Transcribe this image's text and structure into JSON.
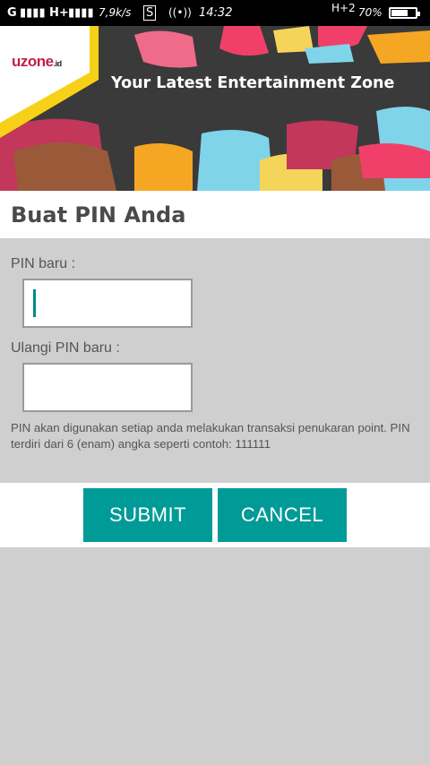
{
  "status_bar": {
    "signal1": "G",
    "signal2": "H+",
    "speed": "7,9k/s",
    "network_badge": "H+2",
    "battery": "70%",
    "time": "14:32",
    "battery_level": 0.7
  },
  "banner": {
    "logo_main": "uzone",
    "logo_suffix": ".id",
    "tagline": "Your Latest Entertainment Zone"
  },
  "page": {
    "title": "Buat PIN Anda"
  },
  "form": {
    "new_pin_label": "PIN baru :",
    "new_pin_value": "",
    "repeat_pin_label": "Ulangi PIN baru :",
    "repeat_pin_value": "",
    "hint": "PIN akan digunakan setiap anda melakukan transaksi penukaran point. PIN terdiri dari 6 (enam) angka seperti contoh: 111111"
  },
  "actions": {
    "submit_label": "SUBMIT",
    "cancel_label": "CANCEL"
  },
  "colors": {
    "accent": "#009b97",
    "banner_bg": "#3a3a3a",
    "logo_red": "#c21f4a",
    "banner_yellow": "#f7d117"
  }
}
